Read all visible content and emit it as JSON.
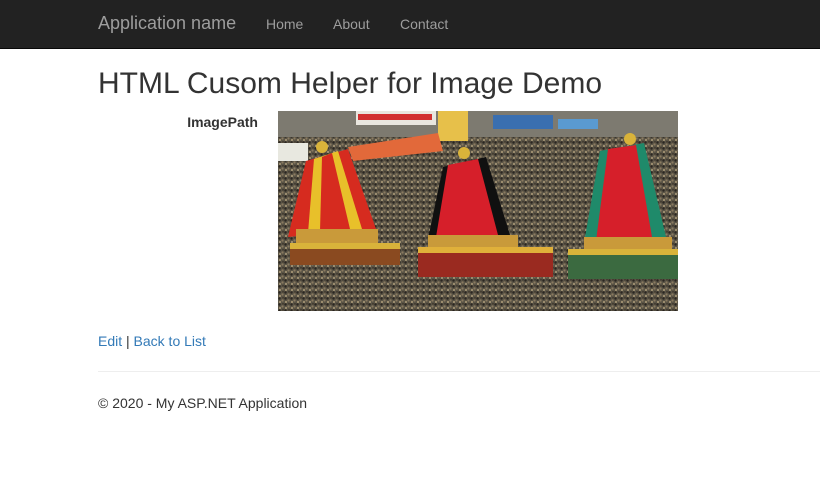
{
  "navbar": {
    "brand": "Application name",
    "links": [
      "Home",
      "About",
      "Contact"
    ]
  },
  "page": {
    "title": "HTML Cusom Helper for Image Demo",
    "field_label": "ImagePath"
  },
  "actions": {
    "edit": "Edit",
    "separator": "|",
    "back": "Back to List"
  },
  "footer": {
    "text": "© 2020 - My ASP.NET Application"
  },
  "colors": {
    "navbar_bg": "#222222",
    "nav_text": "#9d9d9d",
    "link": "#337ab7",
    "text": "#333333"
  }
}
